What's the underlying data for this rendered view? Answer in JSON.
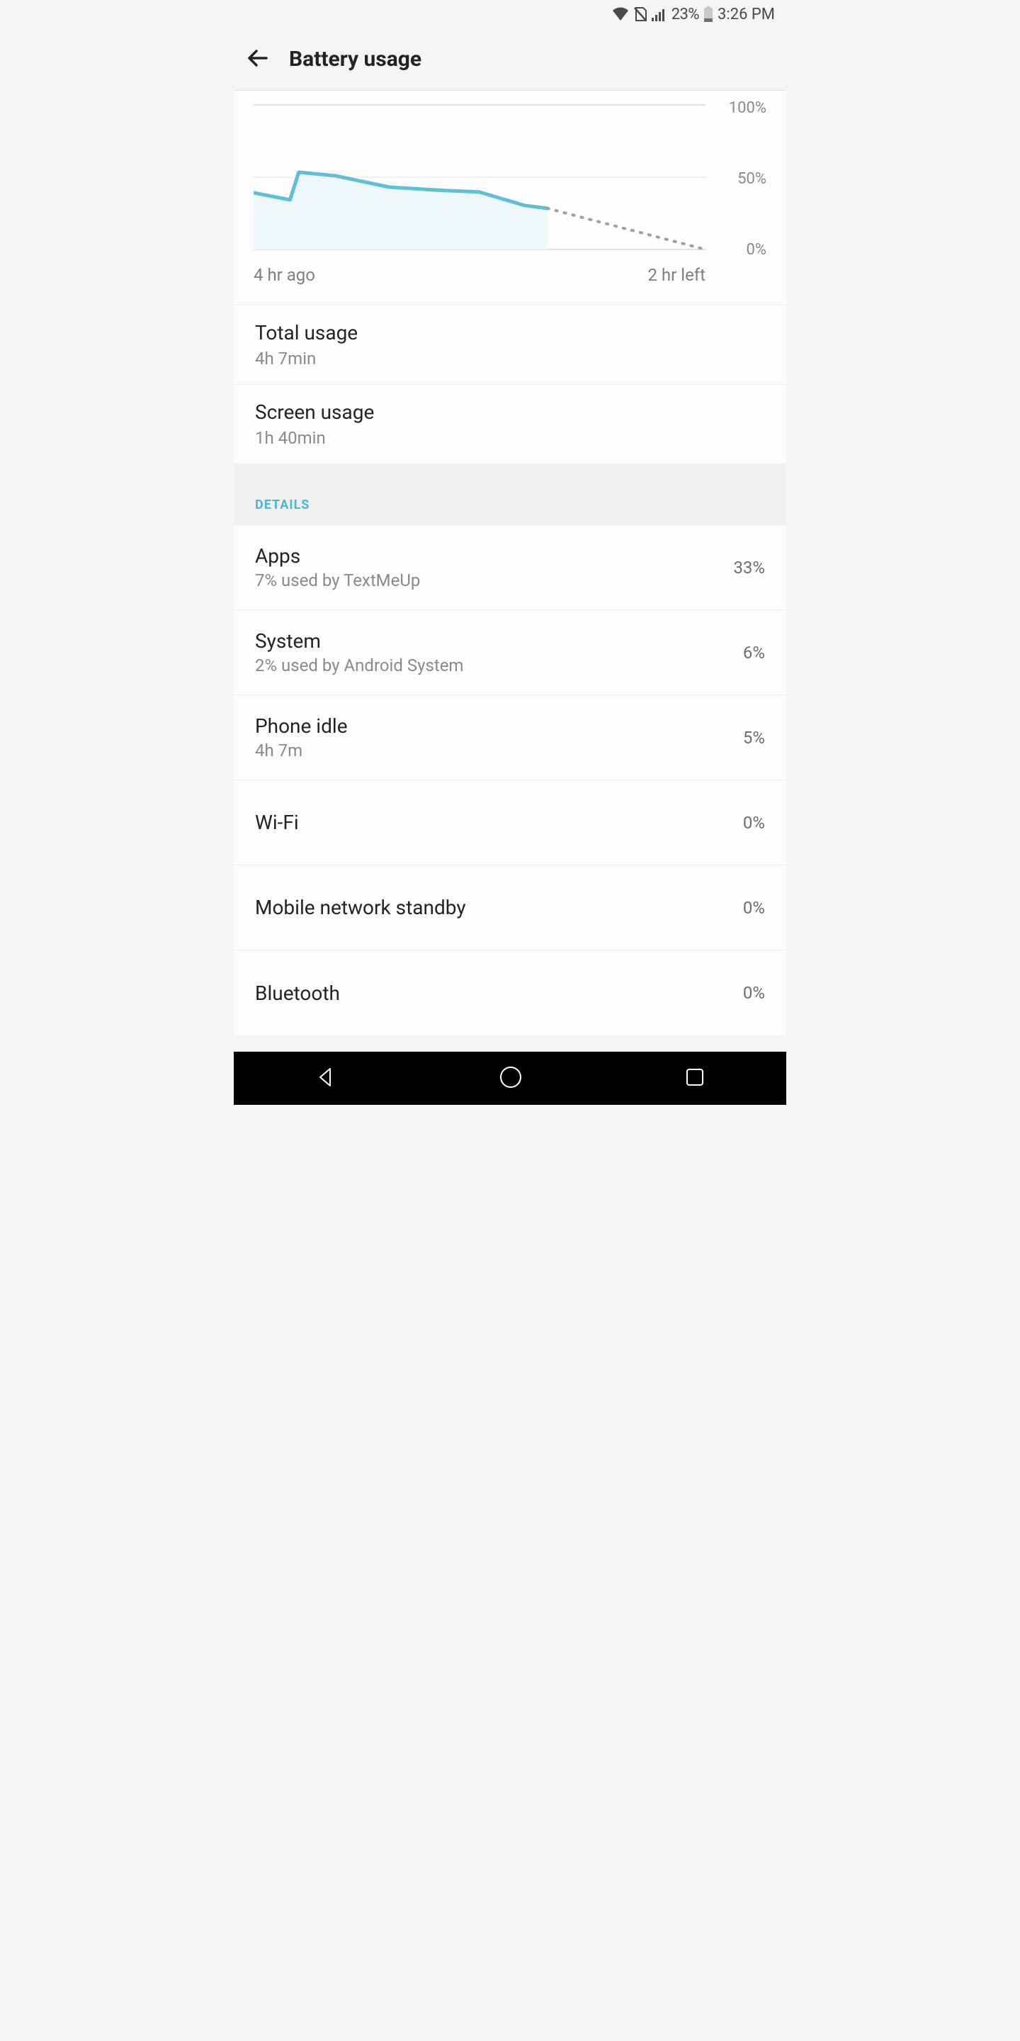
{
  "status_bar": {
    "battery_percent_text": "23%",
    "time": "3:26 PM"
  },
  "header": {
    "title": "Battery usage"
  },
  "chart_data": {
    "type": "line",
    "title": "",
    "xlabel": "",
    "ylabel": "",
    "ylim": [
      0,
      100
    ],
    "x_ticks": [
      "4 hr ago",
      "2 hr left"
    ],
    "y_ticks": [
      "100%",
      "50%",
      "0%"
    ],
    "x": [
      0,
      8,
      10,
      18,
      30,
      40,
      50,
      60,
      65
    ],
    "series": [
      {
        "name": "battery_level",
        "values": [
          40,
          35,
          54,
          50,
          44,
          42,
          40,
          32,
          30
        ],
        "color": "#5fbfd4",
        "style": "solid"
      },
      {
        "name": "projected",
        "x": [
          65,
          100
        ],
        "values": [
          30,
          0
        ],
        "color": "#9aa0a6",
        "style": "dotted"
      }
    ]
  },
  "usage": {
    "total_label": "Total usage",
    "total_value": "4h 7min",
    "screen_label": "Screen usage",
    "screen_value": "1h 40min"
  },
  "details": {
    "header": "DETAILS",
    "items": [
      {
        "name": "Apps",
        "sub": "7% used by TextMeUp",
        "percent": "33%"
      },
      {
        "name": "System",
        "sub": "2% used by Android System",
        "percent": "6%"
      },
      {
        "name": "Phone idle",
        "sub": "4h 7m",
        "percent": "5%"
      },
      {
        "name": "Wi-Fi",
        "sub": "",
        "percent": "0%"
      },
      {
        "name": "Mobile network standby",
        "sub": "",
        "percent": "0%"
      },
      {
        "name": "Bluetooth",
        "sub": "",
        "percent": "0%"
      }
    ]
  }
}
